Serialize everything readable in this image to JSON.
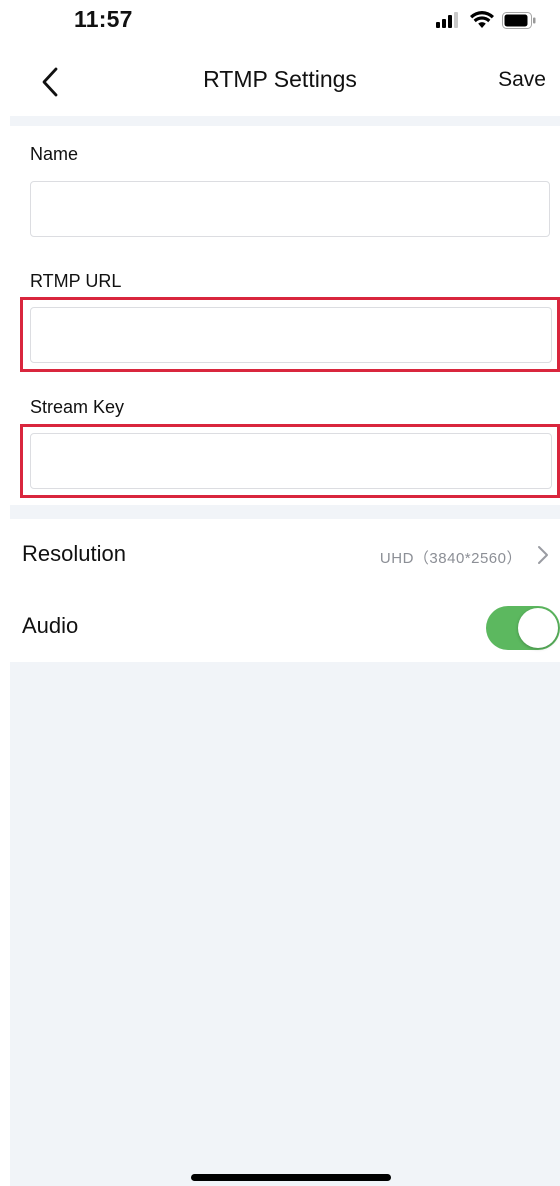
{
  "status_bar": {
    "time": "11:57",
    "icons": [
      "signal-icon",
      "wifi-icon",
      "battery-icon"
    ]
  },
  "nav": {
    "back_icon": "chevron-left-icon",
    "title": "RTMP Settings",
    "save_label": "Save"
  },
  "form": {
    "name": {
      "label": "Name",
      "value": "",
      "placeholder": ""
    },
    "rtmp_url": {
      "label": "RTMP URL",
      "value": "",
      "placeholder": ""
    },
    "stream_key": {
      "label": "Stream Key",
      "value": "",
      "placeholder": ""
    }
  },
  "settings": {
    "resolution": {
      "label": "Resolution",
      "value": "UHD（3840*2560）"
    },
    "audio": {
      "label": "Audio",
      "enabled": true
    }
  },
  "colors": {
    "accent_toggle": "#5cb85f",
    "highlight": "#d9263d",
    "background_gray": "#f1f4f8"
  }
}
